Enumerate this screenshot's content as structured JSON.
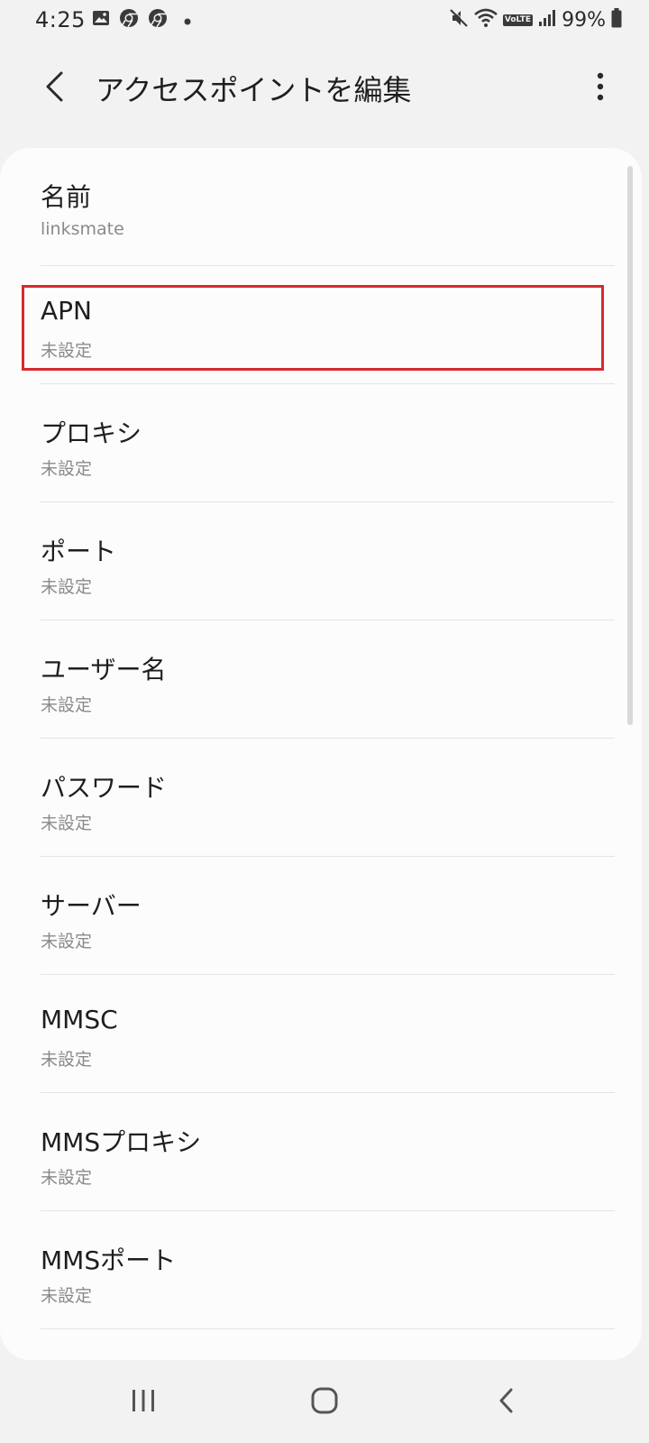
{
  "status_bar": {
    "time": "4:25",
    "battery_percent": "99%",
    "volte_label": "VoLTE",
    "left_icons": [
      "gallery-icon",
      "chrome-icon",
      "chrome-icon",
      "notification-dot-icon"
    ],
    "right_icons": [
      "mute-icon",
      "wifi-icon",
      "volte-icon",
      "signal-icon",
      "battery-icon"
    ]
  },
  "app_bar": {
    "title": "アクセスポイントを編集",
    "back_icon": "chevron-left-icon",
    "menu_icon": "more-vert-icon"
  },
  "settings": {
    "items": [
      {
        "title": "名前",
        "value": "linksmate"
      },
      {
        "title": "APN",
        "value": "未設定"
      },
      {
        "title": "プロキシ",
        "value": "未設定"
      },
      {
        "title": "ポート",
        "value": "未設定"
      },
      {
        "title": "ユーザー名",
        "value": "未設定"
      },
      {
        "title": "パスワード",
        "value": "未設定"
      },
      {
        "title": "サーバー",
        "value": "未設定"
      },
      {
        "title": "MMSC",
        "value": "未設定"
      },
      {
        "title": "MMSプロキシ",
        "value": "未設定"
      },
      {
        "title": "MMSポート",
        "value": "未設定"
      }
    ],
    "highlighted_item": "APN"
  },
  "nav_bar": {
    "icons": [
      "recent-apps-icon",
      "home-icon",
      "back-icon"
    ]
  },
  "colors": {
    "background": "#f2f2f2",
    "card": "#fcfcfc",
    "highlight_border": "#d62a2e",
    "secondary_text": "#8a8a8a"
  }
}
